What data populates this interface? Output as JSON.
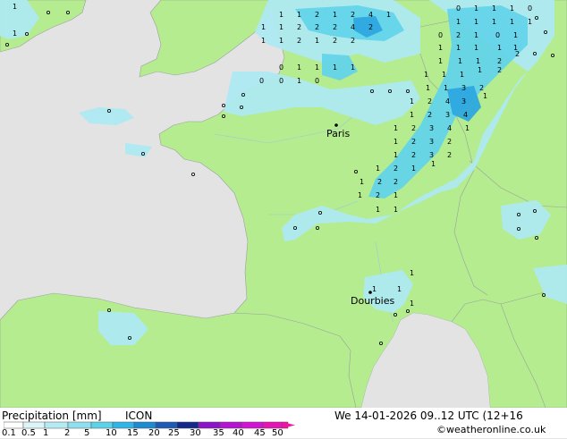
{
  "title": "Precipitation [mm]",
  "model": "ICON",
  "datetime": "We 14-01-2026 09..12 UTC (12+16",
  "credit": "©weatheronline.co.uk",
  "cities": [
    {
      "name": "Paris"
    },
    {
      "name": "Dourbies"
    }
  ],
  "legend": {
    "labels": [
      "0.1",
      "0.5",
      "1",
      "2",
      "5",
      "10",
      "15",
      "20",
      "25",
      "30",
      "35",
      "40",
      "45",
      "50"
    ],
    "colors": [
      "#ffffff",
      "#dcf5f8",
      "#b4ebf3",
      "#8ee0ef",
      "#5ad2e8",
      "#2eb4e6",
      "#1e8ad2",
      "#1e5ab4",
      "#14288c",
      "#8c14c8",
      "#b414d2",
      "#d214d2",
      "#e614b4",
      "#f014a0"
    ]
  },
  "colors": {
    "land": "#b5ec8f",
    "sea": "#e3e3e3",
    "precip_light": "#aeeaf2",
    "precip_mid": "#64d4ea",
    "precip_heavy": "#2ea8e0"
  }
}
